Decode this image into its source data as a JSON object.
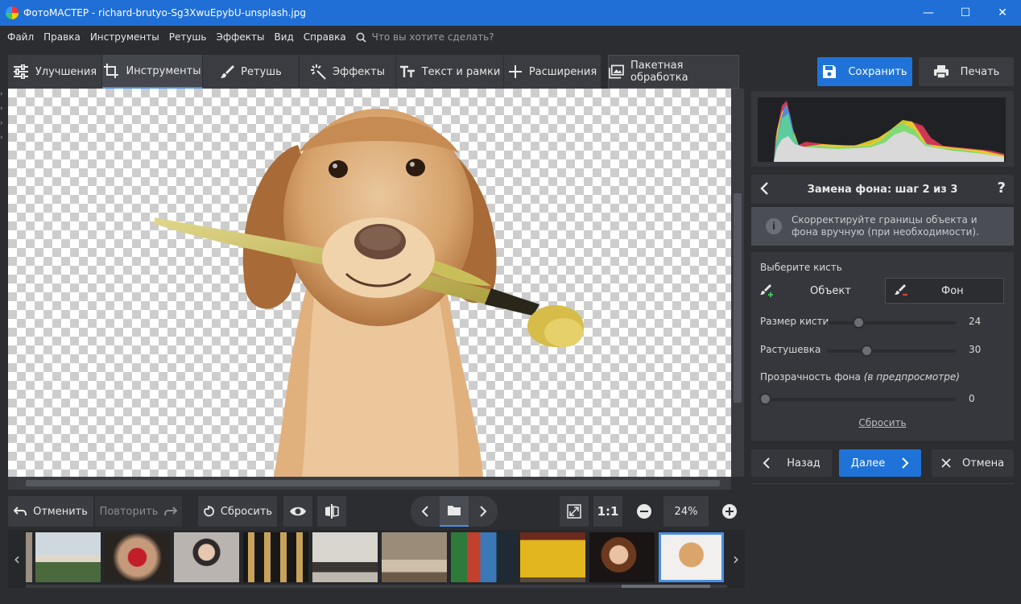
{
  "window": {
    "title": "ФотоМАСТЕР - richard-brutyo-Sg3XwuEpybU-unsplash.jpg",
    "minimize": "—",
    "maximize": "☐",
    "close": "✕"
  },
  "menu": {
    "items": [
      "Файл",
      "Правка",
      "Инструменты",
      "Ретушь",
      "Эффекты",
      "Вид",
      "Справка"
    ],
    "search_placeholder": "Что вы хотите сделать?"
  },
  "tabs": [
    {
      "label": "Улучшения",
      "icon": "sliders-icon"
    },
    {
      "label": "Инструменты",
      "icon": "crop-icon",
      "active": true
    },
    {
      "label": "Ретушь",
      "icon": "brush-icon"
    },
    {
      "label": "Эффекты",
      "icon": "sparkle-icon"
    },
    {
      "label": "Текст и рамки",
      "icon": "text-icon"
    },
    {
      "label": "Расширения",
      "icon": "plus-icon"
    },
    {
      "label": "Пакетная обработка",
      "icon": "images-icon"
    }
  ],
  "toolbar": {
    "undo": "Отменить",
    "redo": "Повторить",
    "reset": "Сбросить",
    "zoom_ratio": "1:1",
    "zoom": "24%"
  },
  "right": {
    "save": "Сохранить",
    "print": "Печать",
    "step_title": "Замена фона: шаг 2 из 3",
    "help": "?",
    "info": "Скорректируйте границы объекта и фона вручную (при необходимости).",
    "choose_brush": "Выберите кисть",
    "brush_object": "Объект",
    "brush_background": "Фон",
    "brush_size_label": "Размер кисти",
    "brush_size_value": "24",
    "feather_label": "Растушевка",
    "feather_value": "30",
    "bg_opacity_label": "Прозрачность фона",
    "bg_opacity_hint": "(в предпросмотре)",
    "bg_opacity_value": "0",
    "reset": "Сбросить",
    "back": "Назад",
    "next": "Далее",
    "cancel": "Отмена"
  },
  "sliders": {
    "brush_size": 0.24,
    "feather": 0.3,
    "bg_opacity": 0
  },
  "colors": {
    "accent": "#1f73d8",
    "titlebar": "#1f6fd6"
  }
}
